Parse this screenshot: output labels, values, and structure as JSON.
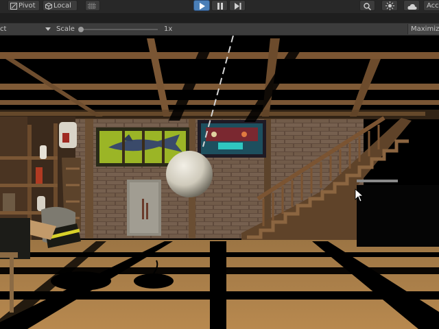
{
  "toolbar": {
    "pivot_label": "Pivot",
    "local_label": "Local",
    "account_label": "Acc",
    "play_state": "playing"
  },
  "game_view": {
    "aspect_label_partial": "ct",
    "scale_label": "Scale",
    "scale_value_label": "1x",
    "scale_value": 1,
    "maximize_label": "Maximize"
  }
}
